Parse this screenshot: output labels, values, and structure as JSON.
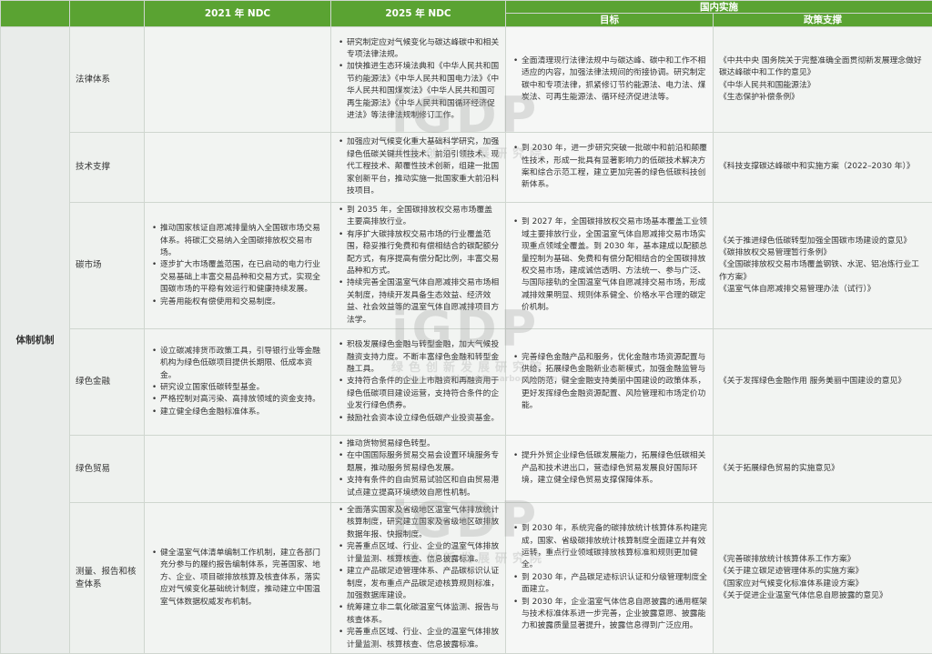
{
  "header": {
    "col_2021": "2021 年 NDC",
    "col_2025": "2025 年 NDC",
    "domestic": "国内实施",
    "goal": "目标",
    "policy": "政策支撑"
  },
  "mechanism": "体制机制",
  "rows": [
    {
      "category": "法律体系",
      "ndc2021": [],
      "ndc2025": [
        "研究制定应对气候变化与碳达峰碳中和相关专项法律法规。",
        "加快推进生态环境法典和《中华人民共和国节约能源法》《中华人民共和国电力法》《中华人民共和国煤炭法》《中华人民共和国可再生能源法》《中华人民共和国循环经济促进法》等法律法规制修订工作。"
      ],
      "goal": [
        "全面清理现行法律法规中与碳达峰、碳中和工作不相适应的内容，加强法律法规间的衔接协调。研究制定碳中和专项法律，抓紧修订节约能源法、电力法、煤炭法、可再生能源法、循环经济促进法等。"
      ],
      "policy": [
        "《中共中央 国务院关于完整准确全面贯彻新发展理念做好碳达峰碳中和工作的意见》",
        "《中华人民共和国能源法》",
        "《生态保护补偿条例》"
      ]
    },
    {
      "category": "技术支撑",
      "ndc2021": [],
      "ndc2025": [
        "加强应对气候变化重大基础科学研究，加强绿色低碳关键共性技术、前沿引领技术、现代工程技术、颠覆性技术创新，组建一批国家创新平台，推动实施一批国家重大前沿科技项目。"
      ],
      "goal": [
        "到 2030 年，进一步研究突破一批碳中和前沿和颠覆性技术，形成一批具有显著影响力的低碳技术解决方案和综合示范工程，建立更加完善的绿色低碳科技创新体系。"
      ],
      "policy": [
        "《科技支撑碳达峰碳中和实施方案（2022–2030 年）》"
      ]
    },
    {
      "category": "碳市场",
      "ndc2021": [
        "推动国家核证自愿减排量纳入全国碳市场交易体系。将碳汇交易纳入全国碳排放权交易市场。",
        "逐步扩大市场覆盖范围，在已启动的电力行业交易基础上丰富交易品种和交易方式，实现全国碳市场的平稳有效运行和健康持续发展。",
        "完善用能权有偿使用和交易制度。"
      ],
      "ndc2025": [
        "到 2035 年，全国碳排放权交易市场覆盖主要高排放行业。",
        "有序扩大碳排放权交易市场的行业覆盖范围，稳妥推行免费和有偿相结合的碳配额分配方式，有序提高有偿分配比例，丰富交易品种和方式。",
        "持续完善全国温室气体自愿减排交易市场相关制度，持续开发具备生态效益、经济效益、社会效益等的温室气体自愿减排项目方法学。"
      ],
      "goal": [
        "到 2027 年，全国碳排放权交易市场基本覆盖工业领域主要排放行业，全国温室气体自愿减排交易市场实现重点领域全覆盖。到 2030 年，基本建成以配额总量控制为基础、免费和有偿分配相结合的全国碳排放权交易市场，建成诚信透明、方法统一、参与广泛、与国际接轨的全国温室气体自愿减排交易市场，形成减排效果明显、规则体系健全、价格水平合理的碳定价机制。"
      ],
      "policy": [
        "《关于推进绿色低碳转型加强全国碳市场建设的意见》",
        "《碳排放权交易管理暂行条例》",
        "《全国碳排放权交易市场覆盖钢铁、水泥、铝冶炼行业工作方案》",
        "《温室气体自愿减排交易管理办法（试行）》"
      ]
    },
    {
      "category": "绿色金融",
      "ndc2021": [
        "设立碳减排货币政策工具，引导银行业等金融机构为绿色低碳项目提供长期限、低成本资金。",
        "研究设立国家低碳转型基金。",
        "严格控制对高污染、高排放领域的资金支持。",
        "建立健全绿色金融标准体系。"
      ],
      "ndc2025": [
        "积极发展绿色金融与转型金融，加大气候投融资支持力度。不断丰富绿色金融和转型金融工具。",
        "支持符合条件的企业上市融资和再融资用于绿色低碳项目建设运营，支持符合条件的企业发行绿色债券。",
        "鼓励社会资本设立绿色低碳产业投资基金。"
      ],
      "goal": [
        "完善绿色金融产品和服务，优化金融市场资源配置与供给，拓展绿色金融新业态新模式，加强金融监管与风险防范，健全金融支持美丽中国建设的政策体系，更好发挥绿色金融资源配置、风险管理和市场定价功能。"
      ],
      "policy": [
        "《关于发挥绿色金融作用 服务美丽中国建设的意见》"
      ]
    },
    {
      "category": "绿色贸易",
      "ndc2021": [],
      "ndc2025": [
        "推动货物贸易绿色转型。",
        "在中国国际服务贸易交易会设置环境服务专题展，推动服务贸易绿色发展。",
        "支持有条件的自由贸易试验区和自由贸易港试点建立提高环境绩效自愿性机制。"
      ],
      "goal": [
        "提升外贸企业绿色低碳发展能力，拓展绿色低碳相关产品和技术进出口，营造绿色贸易发展良好国际环境，建立健全绿色贸易支撑保障体系。"
      ],
      "policy": [
        "《关于拓展绿色贸易的实施意见》"
      ]
    },
    {
      "category": "测量、报告和核查体系",
      "ndc2021": [
        "健全温室气体清单编制工作机制，建立各部门充分参与的履约报告编制体系，完善国家、地方、企业、项目碳排放核算及核查体系，落实应对气候变化基础统计制度，推动建立中国温室气体数据权威发布机制。"
      ],
      "ndc2025": [
        "全面落实国家及省级地区温室气体排放统计核算制度，研究建立国家及省级地区碳排放数据年报、快报制度。",
        "完善重点区域、行业、企业的温室气体排放计量监测、核算核查、信息披露标准。",
        "建立产品碳足迹管理体系、产品碳标识认证制度，发布重点产品碳足迹核算规则标准，加强数据库建设。",
        "统筹建立非二氧化碳温室气体监测、报告与核查体系。",
        "完善重点区域、行业、企业的温室气体排放计量监测、核算核查、信息披露标准。"
      ],
      "goal": [
        "到 2030 年，系统完备的碳排放统计核算体系构建完成，国家、省级碳排放统计核算制度全面建立并有效运转，重点行业领域碳排放核算标准和规则更加健全。",
        "到 2030 年，产品碳足迹标识认证和分级管理制度全面建立。",
        "到 2030 年，企业温室气体信息自愿披露的通用框架与技术标准体系进一步完善，企业披露意愿、披露能力和披露质量显著提升，披露信息得到广泛应用。"
      ],
      "policy": [
        "《完善碳排放统计核算体系工作方案》",
        "《关于建立碳足迹管理体系的实施方案》",
        "《国家应对气候变化标准体系建设方案》",
        "《关于促进企业温室气体信息自愿披露的意见》"
      ]
    }
  ],
  "watermark": {
    "logo": "iGDP",
    "cn": "绿色创新发展研究院",
    "en": "Institute for Global Decarbonization Progress"
  }
}
